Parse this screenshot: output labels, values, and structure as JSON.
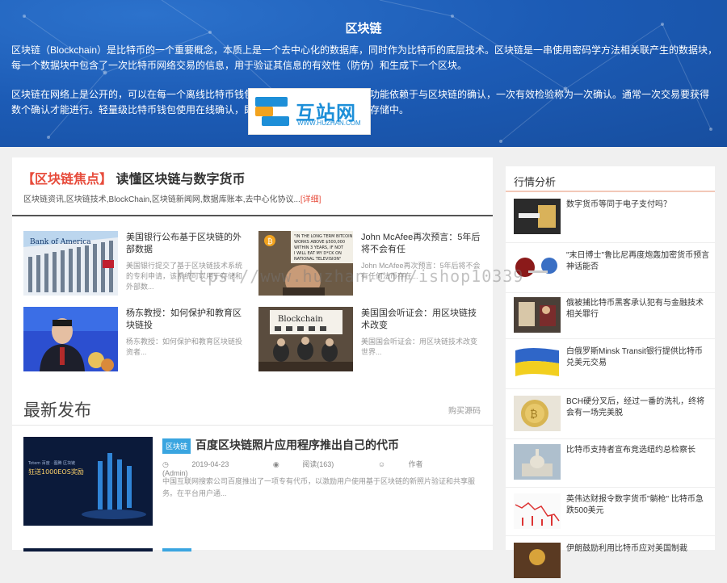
{
  "hero": {
    "title": "区块链",
    "p1": "区块链（Blockchain）是比特币的一个重要概念，本质上是一个去中心化的数据库，同时作为比特币的底层技术。区块链是一串使用密码学方法相关联产生的数据块，每一个数据块中包含了一次比特币网络交易的信息，用于验证其信息的有效性（防伪）和生成下一个区块。",
    "p2": "区块链在网络上是公开的，可以在每一个离线比特币钱包数据中查询。比特币钱包的功能依赖于与区块链的确认，一次有效检验称为一次确认。通常一次交易要获得数个确认才能进行。轻量级比特币钱包使用在线确认，即不会下载区块链数据到设备存储中。"
  },
  "logo": {
    "name": "互站网",
    "url": "WWW.HUZHAN.COM"
  },
  "focus": {
    "tag": "【区块链焦点】",
    "title": "读懂区块链与数字货币",
    "desc": "区块链资讯,区块链技术,BlockChain,区块链新闻网,数据库账本,去中心化协议...",
    "more": "[详细]"
  },
  "cards": [
    {
      "title": "美国银行公布基于区块链的外部数据",
      "excerpt": "美国银行提交了基于区块链技术系统的专利申请，该系统可以用于存储和外部数..."
    },
    {
      "title": "John McAfee再次预言：5年后将不会有任",
      "excerpt": "John McAfee再次预言：5年后将不会有任何法币存在..."
    },
    {
      "title": "杨东教授：如何保护和教育区块链投",
      "excerpt": "杨东教授：如何保护和教育区块链投资者..."
    },
    {
      "title": "美国国会听证会：用区块链技术改变",
      "excerpt": "美国国会听证会：用区块链技术改变世界..."
    }
  ],
  "latest": {
    "heading": "最新发布",
    "link": "购买源码",
    "post": {
      "badge": "区块链",
      "title": "百度区块链照片应用程序推出自己的代币",
      "date": "2019-04-23",
      "views": "阅读(163)",
      "author": "作者(Admin)",
      "excerpt": "中国互联网搜索公司百度推出了一项专有代币，以激励用户使用基于区块链的新照片验证和共享服务。在平台用户通..."
    }
  },
  "side": {
    "heading": "行情分析",
    "items": [
      {
        "title": "数字货币等同于电子支付吗？"
      },
      {
        "title": "\"末日博士\"鲁比尼再度炮轰加密货币预言神话能否"
      },
      {
        "title": "俄被捕比特币黑客承认犯有与金融技术相关罪行"
      },
      {
        "title": "白俄罗斯Minsk Transit银行提供比特币兑美元交易"
      },
      {
        "title": "BCH硬分叉后，经过一番的洗礼，终将会有一场完美脱"
      },
      {
        "title": "比特币支持者宣布竞选纽约总检察长"
      },
      {
        "title": "英伟达财报令数字货币\"躺枪\" 比特币急跌500美元"
      },
      {
        "title": "伊朗鼓励利用比特币应对美国制裁"
      }
    ]
  },
  "watermark": "https://www.huzhan.com/ishop10339",
  "colors": {
    "hero_bg": "#1b5cb8",
    "accent_red": "#e74c3c",
    "badge_blue": "#3aa5e0"
  }
}
